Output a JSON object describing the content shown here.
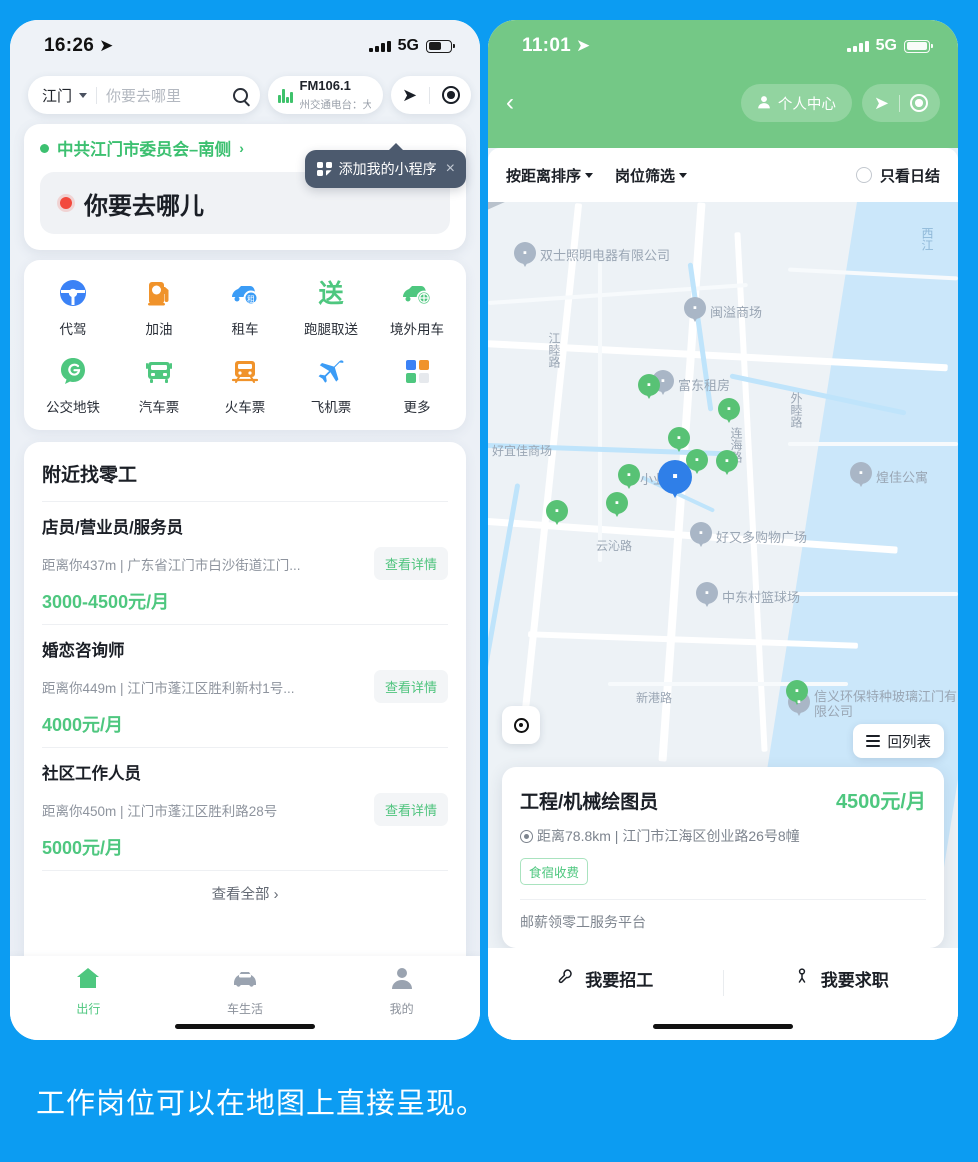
{
  "caption": "工作岗位可以在地图上直接呈现。",
  "background_color": "#0c9cf2",
  "left_phone": {
    "status_bar": {
      "time": "16:26",
      "location_icon": "➤",
      "network": "5G",
      "signal_icon": "signal-bars",
      "battery_icon": "battery"
    },
    "search": {
      "city": "江门",
      "placeholder": "你要去哪里",
      "search_icon": "search-icon"
    },
    "radio_widget": {
      "station": "FM106.1",
      "subtitle": "州交通电台：大",
      "icon": "equalizer-icon"
    },
    "nav_controls": {
      "direction_icon": "➤",
      "compass_icon": "compass-icon"
    },
    "tooltip": {
      "label": "添加我的小程序",
      "close_icon": "×",
      "grid_icon": "mini-program-icon"
    },
    "destination_card": {
      "poi_name": "中共江门市委员会–南侧",
      "poi_chevron": "›",
      "where_to": "你要去哪儿"
    },
    "services": {
      "row1": [
        {
          "label": "代驾",
          "icon": "steering-wheel-icon",
          "color": "#3b82f6"
        },
        {
          "label": "加油",
          "icon": "fuel-pump-icon",
          "color": "#f0932b"
        },
        {
          "label": "租车",
          "icon": "rental-car-icon",
          "color": "#3b9cf6"
        },
        {
          "label": "跑腿取送",
          "icon": "delivery-send-icon",
          "color": "#4ec77f"
        },
        {
          "label": "境外用车",
          "icon": "overseas-car-icon",
          "color": "#4ec77f"
        }
      ],
      "row2": [
        {
          "label": "公交地铁",
          "icon": "bus-metro-icon",
          "color": "#4ec77f"
        },
        {
          "label": "汽车票",
          "icon": "coach-ticket-icon",
          "color": "#4ec77f"
        },
        {
          "label": "火车票",
          "icon": "train-ticket-icon",
          "color": "#f0932b"
        },
        {
          "label": "飞机票",
          "icon": "flight-ticket-icon",
          "color": "#3b9cf6"
        },
        {
          "label": "更多",
          "icon": "more-grid-icon",
          "color": "#3b82f6"
        }
      ]
    },
    "jobs_panel": {
      "title": "附近找零工",
      "detail_button_label": "查看详情",
      "items": [
        {
          "title": "店员/营业员/服务员",
          "meta": "距离你437m | 广东省江门市白沙街道江门...",
          "pay": "3000-4500元/月"
        },
        {
          "title": "婚恋咨询师",
          "meta": "距离你449m | 江门市蓬江区胜利新村1号...",
          "pay": "4000元/月"
        },
        {
          "title": "社区工作人员",
          "meta": "距离你450m | 江门市蓬江区胜利路28号",
          "pay": "5000元/月"
        }
      ],
      "view_all": "查看全部 ›"
    },
    "tabbar": [
      {
        "label": "出行",
        "icon": "home-icon",
        "active": true
      },
      {
        "label": "车生活",
        "icon": "car-icon",
        "active": false
      },
      {
        "label": "我的",
        "icon": "person-icon",
        "active": false
      }
    ]
  },
  "right_phone": {
    "status_bar": {
      "time": "11:01",
      "location_icon": "➤",
      "network": "5G",
      "signal_icon": "signal-bars",
      "battery_icon": "battery"
    },
    "header": {
      "back_icon": "‹",
      "user_center": "个人中心",
      "user_icon": "person-icon",
      "direction_icon": "➤",
      "compass_icon": "compass-icon",
      "accent_color": "#74c886"
    },
    "filter_bar": {
      "sort": "按距离排序",
      "filter": "岗位筛选",
      "only_daily": "只看日结",
      "radio_icon": "radio-unchecked-icon"
    },
    "map": {
      "labels": [
        {
          "text": "西江"
        },
        {
          "text": "江睦路"
        },
        {
          "text": "好宜佳商场"
        },
        {
          "text": "云沁路"
        },
        {
          "text": "新港路"
        },
        {
          "text": "连海路"
        },
        {
          "text": "外睦路"
        }
      ],
      "pois": [
        {
          "text": "双士照明电器有限公司",
          "icon": "bag-pin-grey"
        },
        {
          "text": "闽溢商场",
          "icon": "cart-pin-grey"
        },
        {
          "text": "富东租房",
          "icon": "bed-pin-grey"
        },
        {
          "text": "煌佳公寓",
          "icon": "bed-pin-grey"
        },
        {
          "text": "好又多购物广场",
          "icon": "cart-pin-grey"
        },
        {
          "text": "中东村篮球场",
          "icon": "sport-pin-grey"
        },
        {
          "text": "信义环保特种玻璃江门有限公司",
          "icon": "bag-pin-grey"
        },
        {
          "text": "小业",
          "icon": "bag-pin-green"
        }
      ],
      "locate_icon": "crosshair-icon",
      "back_to_list": "回列表",
      "list_icon": "hamburger-icon"
    },
    "detail_card": {
      "title": "工程/机械绘图员",
      "pay": "4500元/月",
      "meta": "距离78.8km | 江门市江海区创业路26号8幢",
      "tag": "食宿收费",
      "source": "邮薪领零工服务平台",
      "location_icon": "location-pin-icon"
    },
    "bottom_actions": [
      {
        "label": "我要招工",
        "icon": "wrench-icon"
      },
      {
        "label": "我要求职",
        "icon": "person-search-icon"
      }
    ]
  }
}
